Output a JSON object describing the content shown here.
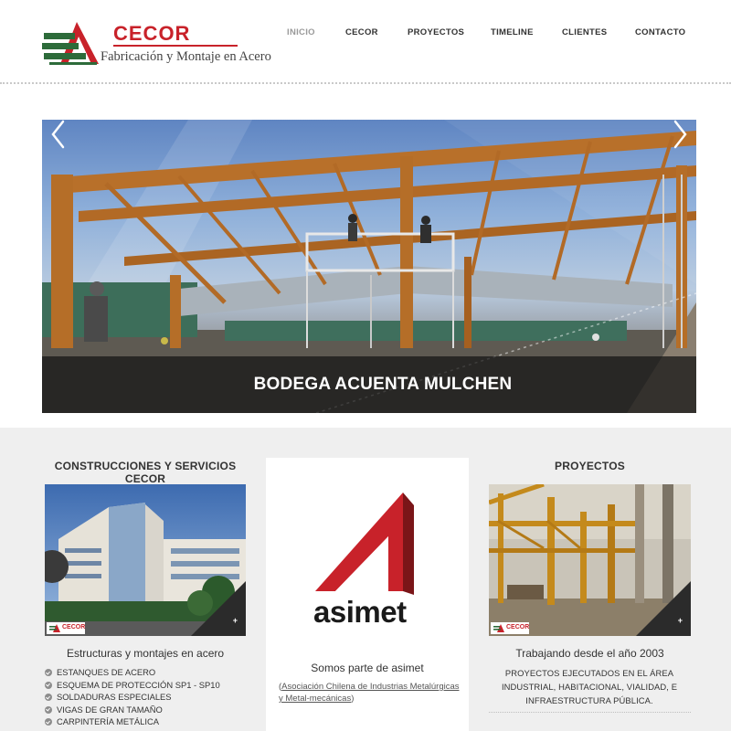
{
  "brand": {
    "name": "CECOR",
    "tagline": "Fabricación y Montaje en Acero",
    "red": "#c8222a",
    "green": "#2d6b3a"
  },
  "nav": {
    "items": [
      {
        "label": "INICIO",
        "active": true
      },
      {
        "label": "CECOR",
        "active": false
      },
      {
        "label": "PROYECTOS",
        "active": false
      },
      {
        "label": "TIMELINE",
        "active": false
      },
      {
        "label": "CLIENTES",
        "active": false
      },
      {
        "label": "CONTACTO",
        "active": false
      }
    ]
  },
  "slider": {
    "caption": "BODEGA ACUENTA MULCHEN",
    "prev_icon": "chevron-left-icon",
    "next_icon": "chevron-right-icon",
    "image": "steel-frame-construction-photo"
  },
  "left_column": {
    "title": "CONSTRUCCIONES Y SERVICIOS CECOR",
    "image": "office-buildings-photo",
    "subtitle": "Estructuras y montajes en acero",
    "bullets": [
      "ESTANQUES DE ACERO",
      "ESQUEMA DE PROTECCIÓN SP1 - SP10",
      "SOLDADURAS ESPECIALES",
      "VIGAS DE GRAN TAMAÑO",
      "CARPINTERÍA METÁLICA"
    ],
    "more_label": "+",
    "watermark": "CECOR"
  },
  "center_column": {
    "logo_word": "asimet",
    "subtitle": "Somos parte de asimet",
    "note_open": "(",
    "note_link": "Asociación Chilena de Industrias Metalúrgicas y Metal-mecánicas",
    "note_close": ")"
  },
  "right_column": {
    "title": "PROYECTOS",
    "image": "steel-structure-project-photo",
    "subtitle": "Trabajando desde el año 2003",
    "description": "PROYECTOS EJECUTADOS EN EL ÁREA INDUSTRIAL, HABITACIONAL, VIALIDAD, E INFRAESTRUCTURA PÚBLICA.",
    "more_label": "+",
    "watermark": "CECOR"
  }
}
